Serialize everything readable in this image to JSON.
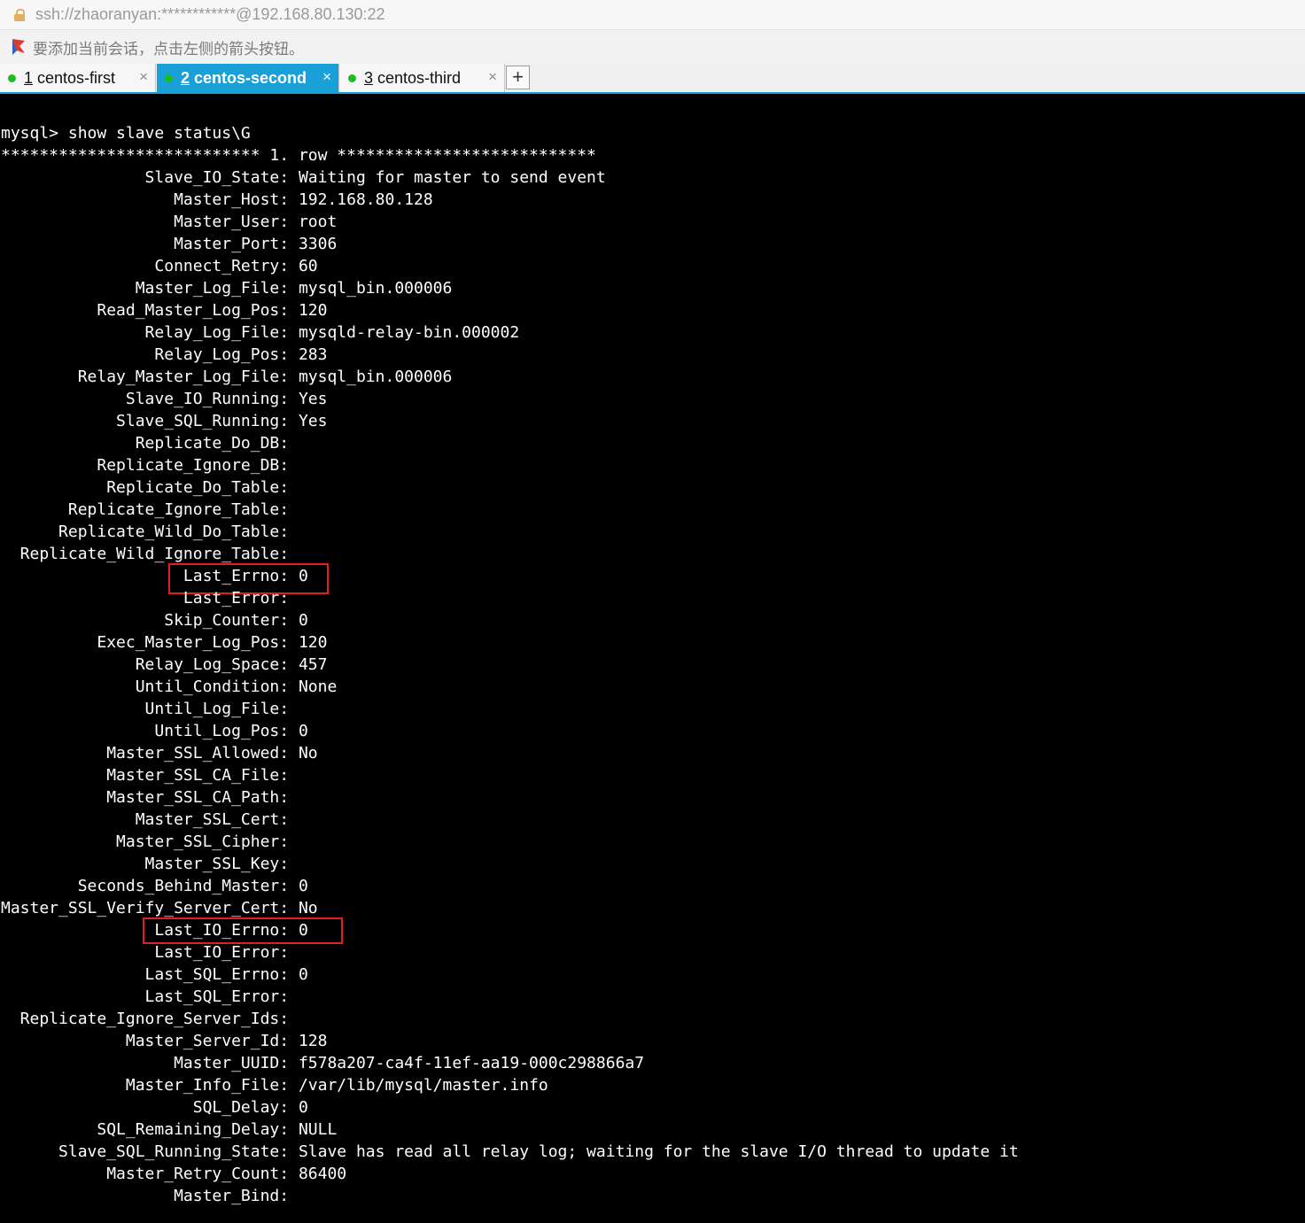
{
  "address": {
    "text": "ssh://zhaoranyan:************@192.168.80.130:22",
    "icon": "lock-icon"
  },
  "hint": {
    "text": "要添加当前会话，点击左侧的箭头按钮。",
    "icon": "arrow-icon"
  },
  "tabs": [
    {
      "num": "1",
      "label": "centos-first",
      "close": "×",
      "active": false
    },
    {
      "num": "2",
      "label": "centos-second",
      "close": "×",
      "active": true
    },
    {
      "num": "3",
      "label": "centos-third",
      "close": "×",
      "active": false
    }
  ],
  "add_tab": "+",
  "colors": {
    "tab_active": "#1aa0d8",
    "status_dot": "#1bbf1b",
    "highlight_box": "#e02020",
    "terminal_bg": "#000000",
    "terminal_fg": "#ffffff"
  },
  "terminal": {
    "lines": [
      "mysql> show slave status\\G",
      "*************************** 1. row ***************************",
      "               Slave_IO_State: Waiting for master to send event",
      "                  Master_Host: 192.168.80.128",
      "                  Master_User: root",
      "                  Master_Port: 3306",
      "                Connect_Retry: 60",
      "              Master_Log_File: mysql_bin.000006",
      "          Read_Master_Log_Pos: 120",
      "               Relay_Log_File: mysqld-relay-bin.000002",
      "                Relay_Log_Pos: 283",
      "        Relay_Master_Log_File: mysql_bin.000006",
      "             Slave_IO_Running: Yes",
      "            Slave_SQL_Running: Yes",
      "              Replicate_Do_DB:",
      "          Replicate_Ignore_DB:",
      "           Replicate_Do_Table:",
      "       Replicate_Ignore_Table:",
      "      Replicate_Wild_Do_Table:",
      "  Replicate_Wild_Ignore_Table:",
      "                   Last_Errno: 0",
      "                   Last_Error:",
      "                 Skip_Counter: 0",
      "          Exec_Master_Log_Pos: 120",
      "              Relay_Log_Space: 457",
      "              Until_Condition: None",
      "               Until_Log_File:",
      "                Until_Log_Pos: 0",
      "           Master_SSL_Allowed: No",
      "           Master_SSL_CA_File:",
      "           Master_SSL_CA_Path:",
      "              Master_SSL_Cert:",
      "            Master_SSL_Cipher:",
      "               Master_SSL_Key:",
      "        Seconds_Behind_Master: 0",
      "Master_SSL_Verify_Server_Cert: No",
      "                Last_IO_Errno: 0",
      "                Last_IO_Error:",
      "               Last_SQL_Errno: 0",
      "               Last_SQL_Error:",
      "  Replicate_Ignore_Server_Ids:",
      "             Master_Server_Id: 128",
      "                  Master_UUID: f578a207-ca4f-11ef-aa19-000c298866a7",
      "             Master_Info_File: /var/lib/mysql/master.info",
      "                    SQL_Delay: 0",
      "          SQL_Remaining_Delay: NULL",
      "      Slave_SQL_Running_State: Slave has read all relay log; waiting for the slave I/O thread to update it",
      "           Master_Retry_Count: 86400",
      "                  Master_Bind:"
    ]
  }
}
